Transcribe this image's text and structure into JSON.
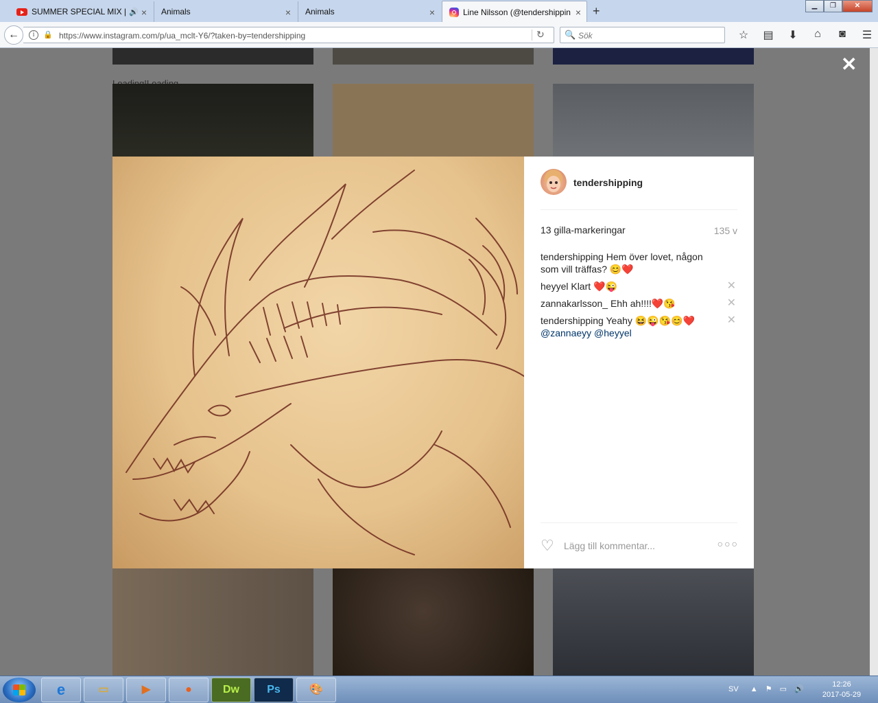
{
  "tabs": [
    {
      "label": "SUMMER SPECIAL MIX | ",
      "icon": "youtube-icon"
    },
    {
      "label": "Animals"
    },
    {
      "label": "Animals"
    },
    {
      "label": "Line Nilsson (@tendershippin",
      "icon": "instagram-icon",
      "active": true
    }
  ],
  "navbar": {
    "url": "https://www.instagram.com/p/ua_mclt-Y6/?taken-by=tendershipping",
    "search_placeholder": "Sök"
  },
  "page": {
    "loading_text": "Loading!Loading..."
  },
  "post": {
    "username": "tendershipping",
    "likes": "13 gilla-markeringar",
    "age": "135 v",
    "comments": [
      {
        "user": "tendershipping",
        "text": " Hem över lovet, någon som vill träffas? 😊❤️",
        "deletable": false
      },
      {
        "user": "heyyel",
        "text": " Klart ❤️😜",
        "deletable": true
      },
      {
        "user": "zannakarlsson_",
        "text": " Ehh ah!!!!❤️😘",
        "deletable": true
      },
      {
        "user": "tendershipping",
        "text": " Yeahy 😆😜😘😊❤️",
        "mentions": "@zannaeyy @heyyel",
        "deletable": true
      }
    ],
    "comment_placeholder": "Lägg till kommentar..."
  },
  "taskbar": {
    "apps": [
      "ie-icon",
      "explorer-icon",
      "media-player-icon",
      "firefox-icon",
      "Dw",
      "Ps",
      "paint-icon"
    ],
    "language": "SV",
    "time": "12:26",
    "date": "2017-05-29"
  }
}
